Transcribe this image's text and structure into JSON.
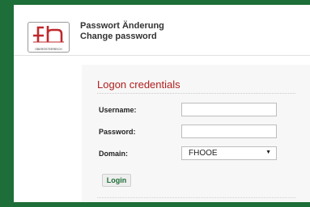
{
  "header": {
    "logo_text": "OBERÖSTERREICH",
    "title_de": "Passwort Änderung",
    "title_en": "Change password"
  },
  "form": {
    "section_title": "Logon credentials",
    "username_label": "Username:",
    "username_value": "",
    "password_label": "Password:",
    "password_value": "",
    "domain_label": "Domain:",
    "domain_value": "FHOOE",
    "login_label": "Login"
  },
  "colors": {
    "background_green": "#1d6e38",
    "accent_red": "#b0201f",
    "login_text_green": "#1c6e35"
  }
}
